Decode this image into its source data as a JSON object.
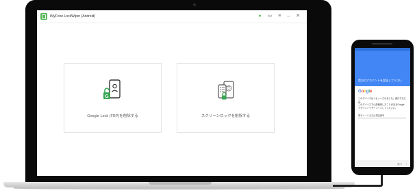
{
  "app": {
    "title": "iMyFone LockWiper (Android)",
    "brand_color": "#5cb85c",
    "titlebar_icons": [
      "user-icon",
      "feedback-icon",
      "menu-icon",
      "minimize-icon",
      "close-icon"
    ],
    "titlebar_glyphs": {
      "user": "●",
      "feedback": "▭",
      "menu": "≡",
      "minimize": "–",
      "close": "✕"
    }
  },
  "cards": [
    {
      "id": "frp",
      "label": "Google Lock (FRP)を削除する",
      "icon": "phone-unlock-icon",
      "badge": "G"
    },
    {
      "id": "screen",
      "label": "スクリーンロックを削除する",
      "icon": "phone-lock-types-icon"
    }
  ],
  "phone": {
    "header_color": "#4285f4",
    "header_text": "貴方のアカウントを認証して下さい",
    "google_logo": [
      "G",
      "o",
      "o",
      "g",
      "l",
      "e"
    ],
    "body_lines": [
      "このデバイスはリセットされました。続行するには、",
      "このデバイスで以前使用したことがあるGoogle",
      "アカウントでサインインしてください。"
    ],
    "input_placeholder": "電子メールまたは電話番号",
    "next_label": "次へ",
    "next_arrow": "›"
  }
}
